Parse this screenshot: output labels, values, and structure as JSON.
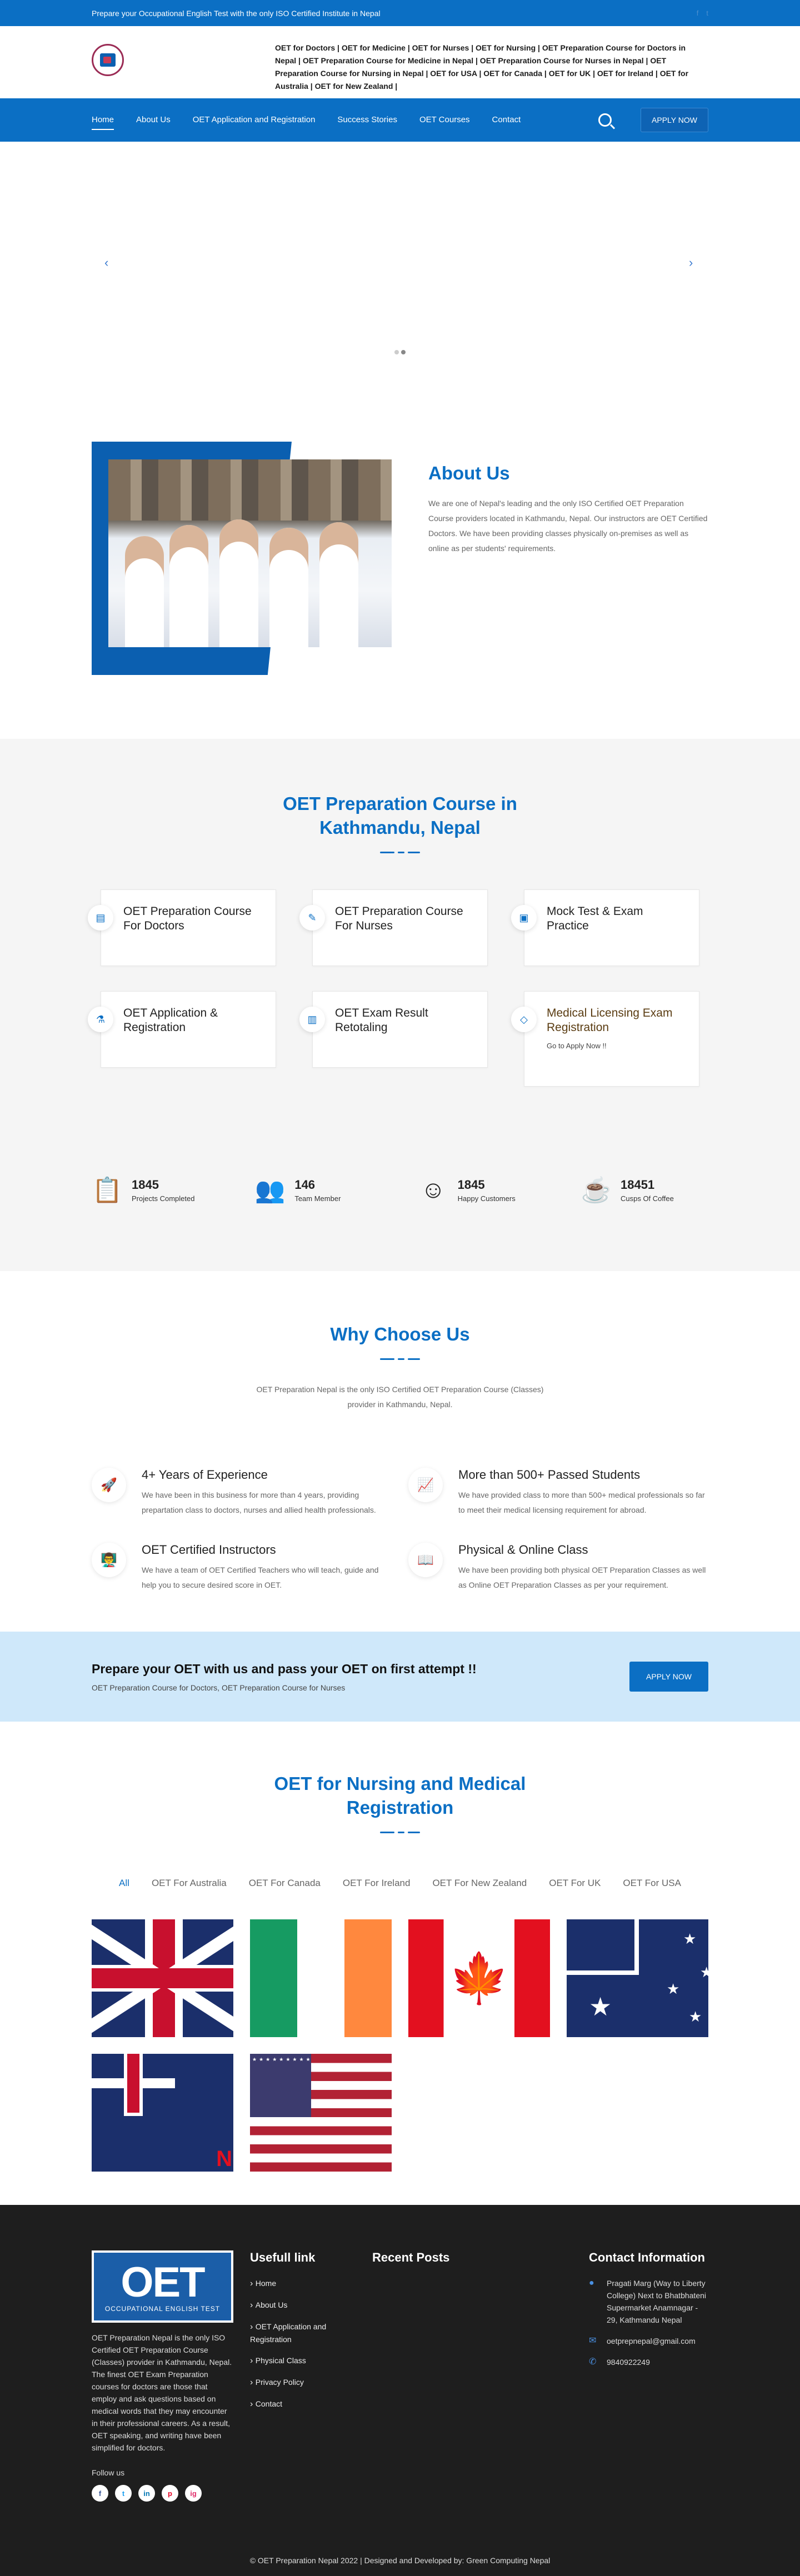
{
  "topbar": {
    "text": "Prepare your Occupational English Test with the only ISO Certified Institute in Nepal",
    "social_icons": [
      "facebook-icon",
      "twitter-icon"
    ]
  },
  "header": {
    "tagline": "OET for Doctors | OET for Medicine | OET for Nurses | OET for Nursing | OET Preparation Course for Doctors in Nepal | OET Preparation Course for Medicine in Nepal | OET Preparation Course for Nurses in Nepal | OET Preparation Course for Nursing in Nepal | OET for USA | OET for Canada | OET for UK | OET for Ireland | OET for Australia | OET for New Zealand |"
  },
  "nav": {
    "items": [
      "Home",
      "About Us",
      "OET Application and Registration",
      "Success Stories",
      "OET Courses",
      "Contact"
    ],
    "apply": "APPLY NOW"
  },
  "slider": {
    "prev": "‹",
    "next": "›"
  },
  "about": {
    "title": "About Us",
    "text": "We are one of Nepal's leading and the only ISO Certified OET Preparation Course providers located in Kathmandu, Nepal. Our instructors are OET Certified Doctors. We have been providing classes physically on-premises as well as online as per students' requirements."
  },
  "course": {
    "title": "OET Preparation Course in Kathmandu, Nepal",
    "cards": [
      {
        "title": "OET Preparation Course For Doctors",
        "icon": "book-icon"
      },
      {
        "title": "OET Preparation Course For Nurses",
        "icon": "edit-icon"
      },
      {
        "title": "Mock Test & Exam Practice",
        "icon": "image-icon"
      },
      {
        "title": "OET Application & Registration",
        "icon": "flask-icon"
      },
      {
        "title": "OET Exam Result Retotaling",
        "icon": "chart-icon"
      },
      {
        "title": "Medical Licensing Exam Registration",
        "icon": "diamond-icon",
        "link": "Go to Apply Now !!"
      }
    ],
    "stats": [
      {
        "num": "1845",
        "label": "Projects Completed",
        "icon": "clipboard-icon"
      },
      {
        "num": "146",
        "label": "Team Member",
        "icon": "team-icon"
      },
      {
        "num": "1845",
        "label": "Happy Customers",
        "icon": "customer-icon"
      },
      {
        "num": "18451",
        "label": "Cusps Of Coffee",
        "icon": "coffee-icon"
      }
    ]
  },
  "why": {
    "title": "Why Choose Us",
    "intro": "OET Preparation Nepal is the only ISO Certified OET Preparation Course (Classes) provider in Kathmandu, Nepal.",
    "items": [
      {
        "title": "4+ Years of Experience",
        "text": "We have been in this business for more than 4 years, providing prepartation class to doctors, nurses and allied health professionals.",
        "icon": "rocket-icon"
      },
      {
        "title": "More than 500+ Passed Students",
        "text": "We have provided class to more than 500+ medical professionals so far to meet their medical licensing requirement for abroad.",
        "icon": "growth-chart-icon"
      },
      {
        "title": "OET Certified Instructors",
        "text": "We have a team of OET Certified Teachers who will teach, guide and help you to secure desired score in OET.",
        "icon": "instructor-icon"
      },
      {
        "title": "Physical & Online Class",
        "text": "We have been providing both physical OET Preparation Classes as well as Online OET Preparation Classes as per your requirement.",
        "icon": "book-open-icon"
      }
    ]
  },
  "cta": {
    "title": "Prepare your OET with us and pass your OET on first attempt !!",
    "sub": "OET Preparation Course for Doctors, OET Preparation Course for Nurses",
    "button": "APPLY NOW"
  },
  "nursing": {
    "title": "OET for Nursing and Medical Registration",
    "filters": [
      "All",
      "OET For Australia",
      "OET For Canada",
      "OET For Ireland",
      "OET For New Zealand",
      "OET For UK",
      "OET For USA"
    ],
    "flags": [
      "uk-flag",
      "ireland-flag",
      "canada-flag",
      "australia-flag",
      "new-zealand-flag",
      "usa-flag"
    ]
  },
  "footer": {
    "logo_big": "OET",
    "logo_small": "OCCUPATIONAL ENGLISH TEST",
    "desc": "OET Preparation Nepal is the only ISO Certified OET Preparation Course (Classes) provider in Kathmandu, Nepal. The finest OET Exam Preparation courses for doctors are those that employ and ask questions based on medical words that they may encounter in their professional careers. As a result, OET speaking, and writing have been simplified for doctors.",
    "follow": "Follow us",
    "socials": [
      "f",
      "t",
      "in",
      "p",
      "ig"
    ],
    "useful_title": "Usefull link",
    "links": [
      "Home",
      "About Us",
      "OET Application and Registration",
      "Physical Class",
      "Privacy Policy",
      "Contact"
    ],
    "recent_title": "Recent Posts",
    "contact_title": "Contact Information",
    "address": "Pragati Marg (Way to Liberty College) Next to Bhatbhateni Supermarket Anamnagar - 29, Kathmandu Nepal",
    "email": "oetprepnepal@gmail.com",
    "phone": "9840922249",
    "copyright": "© OET Preparation Nepal 2022 | Designed and Developed by: Green Computing Nepal"
  }
}
